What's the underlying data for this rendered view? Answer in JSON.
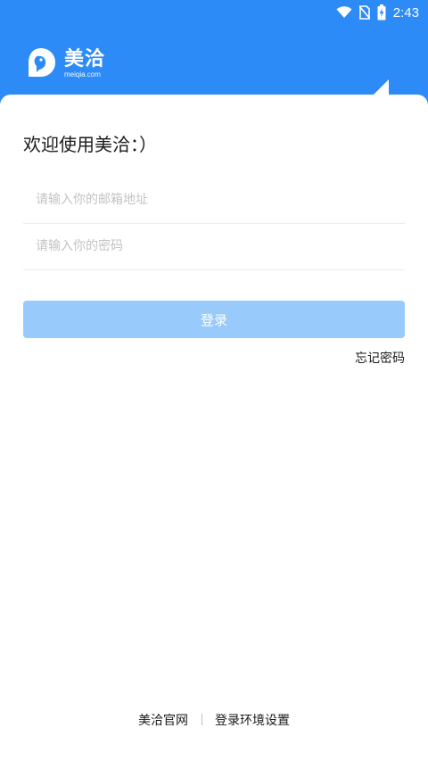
{
  "status_bar": {
    "time": "2:43",
    "icons": [
      "wifi-icon",
      "no-sim-icon",
      "battery-charging-icon"
    ]
  },
  "brand": {
    "name": "美洽",
    "domain": "meiqia.com",
    "logo_icon": "meiqia-logo-icon"
  },
  "login": {
    "welcome": "欢迎使用美洽：）",
    "email_placeholder": "请输入你的邮箱地址",
    "password_placeholder": "请输入你的密码",
    "login_label": "登录",
    "forgot_label": "忘记密码"
  },
  "footer": {
    "website_label": "美洽官网",
    "env_label": "登录环境设置"
  },
  "colors": {
    "header_bg": "#2d8bf8",
    "button_bg": "#98cbfb",
    "text_primary": "#1a1a1a",
    "placeholder": "#c3c3c3"
  }
}
